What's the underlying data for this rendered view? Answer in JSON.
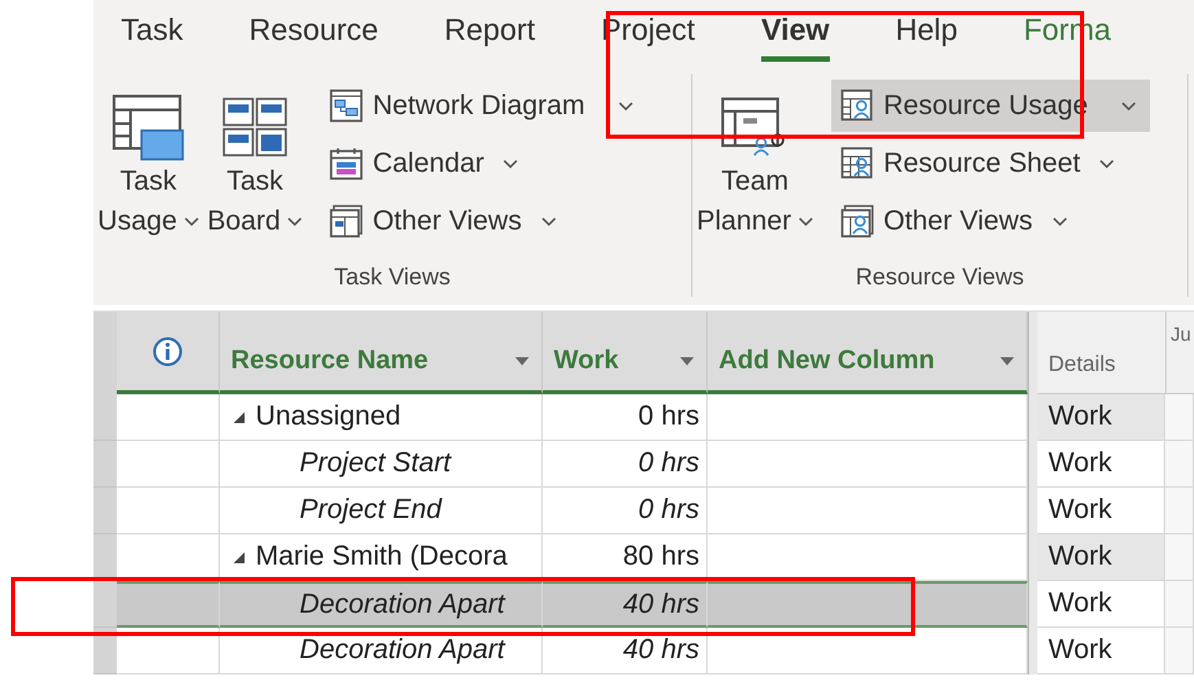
{
  "ribbon_tabs": [
    {
      "label": "Task",
      "selected": false,
      "kind": "normal"
    },
    {
      "label": "Resource",
      "selected": false,
      "kind": "normal"
    },
    {
      "label": "Report",
      "selected": false,
      "kind": "normal"
    },
    {
      "label": "Project",
      "selected": false,
      "kind": "normal"
    },
    {
      "label": "View",
      "selected": true,
      "kind": "normal"
    },
    {
      "label": "Help",
      "selected": false,
      "kind": "normal"
    },
    {
      "label": "Forma",
      "selected": false,
      "kind": "contextual"
    }
  ],
  "groups": [
    {
      "label": "Task Views",
      "large": [
        {
          "line1": "Task",
          "line2": "Usage",
          "kind": "usage"
        },
        {
          "line1": "Task",
          "line2": "Board",
          "kind": "board"
        }
      ],
      "small": [
        {
          "label": "Network Diagram",
          "kind": "network",
          "selected": false
        },
        {
          "label": "Calendar",
          "kind": "calendar",
          "selected": false
        },
        {
          "label": "Other Views",
          "kind": "other",
          "selected": false
        }
      ]
    },
    {
      "label": "Resource Views",
      "large": [
        {
          "line1": "Team",
          "line2": "Planner",
          "kind": "team"
        }
      ],
      "small": [
        {
          "label": "Resource Usage",
          "kind": "resusage",
          "selected": true
        },
        {
          "label": "Resource Sheet",
          "kind": "ressheet",
          "selected": false
        },
        {
          "label": "Other Views",
          "kind": "resother",
          "selected": false
        }
      ]
    }
  ],
  "table": {
    "columns": [
      "Resource Name",
      "Work",
      "Add New Column"
    ],
    "details_header": "Details",
    "timescale_header": "Ju",
    "rows": [
      {
        "kind": "resource",
        "name": "Unassigned",
        "work": "0 hrs",
        "details": "Work",
        "expanded": true,
        "selected": false
      },
      {
        "kind": "assignment",
        "name": "Project Start",
        "work": "0 hrs",
        "details": "Work",
        "selected": false
      },
      {
        "kind": "assignment",
        "name": "Project End",
        "work": "0 hrs",
        "details": "Work",
        "selected": false
      },
      {
        "kind": "resource",
        "name": "Marie Smith (Decora",
        "work": "80 hrs",
        "details": "Work",
        "expanded": true,
        "selected": false
      },
      {
        "kind": "assignment",
        "name": "Decoration Apart",
        "work": "40 hrs",
        "details": "Work",
        "selected": true,
        "highlighted": true
      },
      {
        "kind": "assignment",
        "name": "Decoration Apart",
        "work": "40 hrs",
        "details": "Work",
        "selected": false
      }
    ]
  },
  "tabs_highlighted": true
}
